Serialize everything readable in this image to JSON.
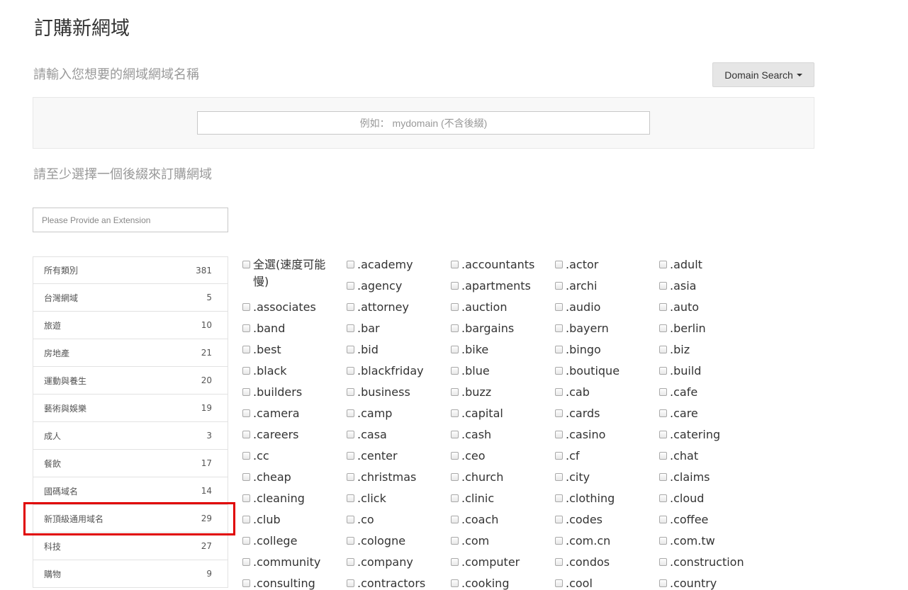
{
  "page": {
    "title": "訂購新網域",
    "search_subtitle": "請輸入您想要的網域網域名稱",
    "tld_subtitle": "請至少選擇一個後綴來訂購網域"
  },
  "search": {
    "dropdown_label": "Domain Search",
    "domain_placeholder": "例如： mydomain (不含後綴)"
  },
  "extension_filter": {
    "placeholder": "Please Provide an Extension"
  },
  "categories": [
    {
      "label": "所有類別",
      "count": "381"
    },
    {
      "label": "台灣網域",
      "count": "5"
    },
    {
      "label": "旅遊",
      "count": "10"
    },
    {
      "label": "房地產",
      "count": "21"
    },
    {
      "label": "運動與養生",
      "count": "20"
    },
    {
      "label": "藝術與娛樂",
      "count": "19"
    },
    {
      "label": "成人",
      "count": "3"
    },
    {
      "label": "餐飲",
      "count": "17"
    },
    {
      "label": "國碼域名",
      "count": "14"
    },
    {
      "label": "新頂級通用域名",
      "count": "29"
    },
    {
      "label": "科技",
      "count": "27"
    },
    {
      "label": "購物",
      "count": "9"
    }
  ],
  "highlight_color": "#e00000",
  "tld_grid": {
    "select_all": "全選(速度可能慢)",
    "first_rows": [
      [
        ".academy",
        ".accountants",
        ".actor",
        ".adult"
      ],
      [
        ".agency",
        ".apartments",
        ".archi",
        ".asia"
      ]
    ],
    "rows": [
      [
        ".associates",
        ".attorney",
        ".auction",
        ".audio",
        ".auto"
      ],
      [
        ".band",
        ".bar",
        ".bargains",
        ".bayern",
        ".berlin"
      ],
      [
        ".best",
        ".bid",
        ".bike",
        ".bingo",
        ".biz"
      ],
      [
        ".black",
        ".blackfriday",
        ".blue",
        ".boutique",
        ".build"
      ],
      [
        ".builders",
        ".business",
        ".buzz",
        ".cab",
        ".cafe"
      ],
      [
        ".camera",
        ".camp",
        ".capital",
        ".cards",
        ".care"
      ],
      [
        ".careers",
        ".casa",
        ".cash",
        ".casino",
        ".catering"
      ],
      [
        ".cc",
        ".center",
        ".ceo",
        ".cf",
        ".chat"
      ],
      [
        ".cheap",
        ".christmas",
        ".church",
        ".city",
        ".claims"
      ],
      [
        ".cleaning",
        ".click",
        ".clinic",
        ".clothing",
        ".cloud"
      ],
      [
        ".club",
        ".co",
        ".coach",
        ".codes",
        ".coffee"
      ],
      [
        ".college",
        ".cologne",
        ".com",
        ".com.cn",
        ".com.tw"
      ],
      [
        ".community",
        ".company",
        ".computer",
        ".condos",
        ".construction"
      ],
      [
        ".consulting",
        ".contractors",
        ".cooking",
        ".cool",
        ".country"
      ]
    ]
  }
}
